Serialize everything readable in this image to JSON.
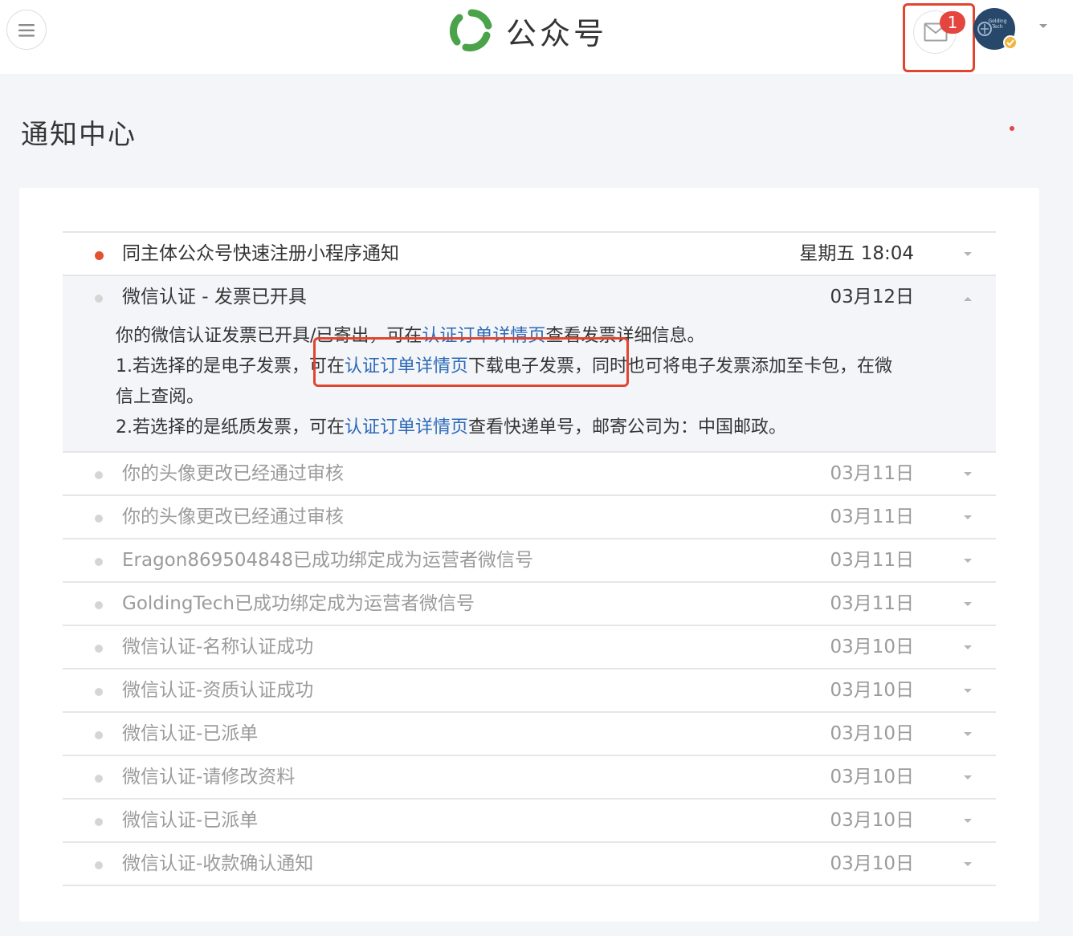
{
  "header": {
    "brand_name": "公众号",
    "mail_badge": "1",
    "avatar_text": "Golding Tech"
  },
  "page": {
    "title": "通知中心"
  },
  "notifications": [
    {
      "title": "同主体公众号快速注册小程序通知",
      "date": "星期五 18:04",
      "unread": true
    },
    {
      "title": "微信认证 - 发票已开具",
      "date": "03月12日",
      "expanded": true
    },
    {
      "title": "你的头像更改已经通过审核",
      "date": "03月11日"
    },
    {
      "title": "你的头像更改已经通过审核",
      "date": "03月11日"
    },
    {
      "title": "Eragon869504848已成功绑定成为运营者微信号",
      "date": "03月11日"
    },
    {
      "title": "GoldingTech已成功绑定成为运营者微信号",
      "date": "03月11日"
    },
    {
      "title": "微信认证-名称认证成功",
      "date": "03月10日"
    },
    {
      "title": "微信认证-资质认证成功",
      "date": "03月10日"
    },
    {
      "title": "微信认证-已派单",
      "date": "03月10日"
    },
    {
      "title": "微信认证-请修改资料",
      "date": "03月10日"
    },
    {
      "title": "微信认证-已派单",
      "date": "03月10日"
    },
    {
      "title": "微信认证-收款确认通知",
      "date": "03月10日"
    }
  ],
  "detail": {
    "line1_pre": "你的微信认证发票已开具/已寄出，可在",
    "line1_link": "认证订单详情页",
    "line1_post": "查看发票详细信息。",
    "line2_pre": "1.若选择的是电子发票，可在",
    "line2_link": "认证订单详情页",
    "line2_post": "下载电子发票，同时也可将电子发票添加至卡包，在微信上查阅。",
    "line3_pre": "2.若选择的是纸质发票，可在",
    "line3_link": "认证订单详情页",
    "line3_post": "查看快递单号，邮寄公司为：中国邮政。"
  },
  "colors": {
    "accent_red": "#e0462f",
    "link_blue": "#2c6ab6",
    "brand_green": "#4aa34a",
    "background": "#f4f5f9"
  }
}
